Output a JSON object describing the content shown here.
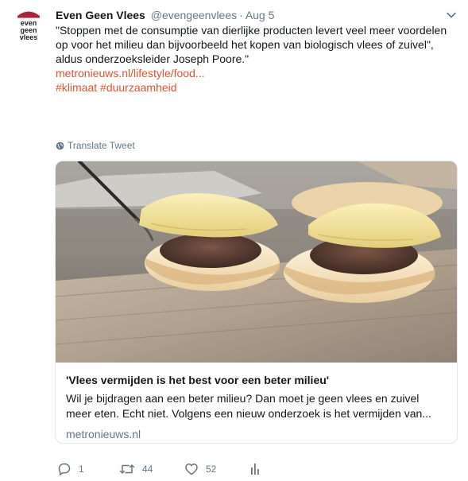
{
  "author": {
    "name": "Even Geen Vlees",
    "handle": "@evengeenvlees",
    "separator": "·",
    "date": "Aug 5",
    "logo_lines": [
      "even",
      "geen",
      "vlees"
    ]
  },
  "tweet": {
    "text": "\"Stoppen met de consumptie van dierlijke producten levert veel meer voordelen op voor het milieu dan bijvoorbeeld het kopen van biologisch vlees of zuivel\", aldus onderzoeksleider Joseph Poore.\"",
    "link": "metronieuws.nl/lifestyle/food...",
    "hashtags": [
      "#klimaat",
      "#duurzaamheid"
    ],
    "translate_label": "Translate Tweet"
  },
  "card": {
    "title": "'Vlees vermijden is het best voor een beter milieu'",
    "description": "Wil je bijdragen aan een beter milieu? Dan moet je geen vlees en zuivel meer eten. Echt niet. Volgens een nieuw onderzoek is het vermijden van...",
    "domain": "metronieuws.nl"
  },
  "actions": {
    "reply_count": "1",
    "retweet_count": "44",
    "like_count": "52"
  },
  "colors": {
    "accent_link": "#e0542f",
    "secondary_text": "#657786",
    "logo_red": "#a8243a"
  }
}
